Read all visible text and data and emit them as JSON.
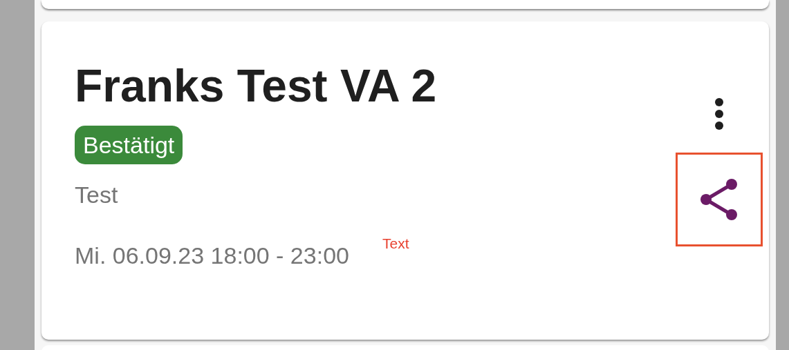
{
  "event_card": {
    "title": "Franks Test VA 2",
    "status": {
      "label": "Bestätigt",
      "color": "#3b8a3b"
    },
    "description": "Test",
    "schedule": "Mi. 06.09.23 18:00 - 23:00",
    "note": "Text",
    "share_button": {
      "highlighted": true
    }
  }
}
